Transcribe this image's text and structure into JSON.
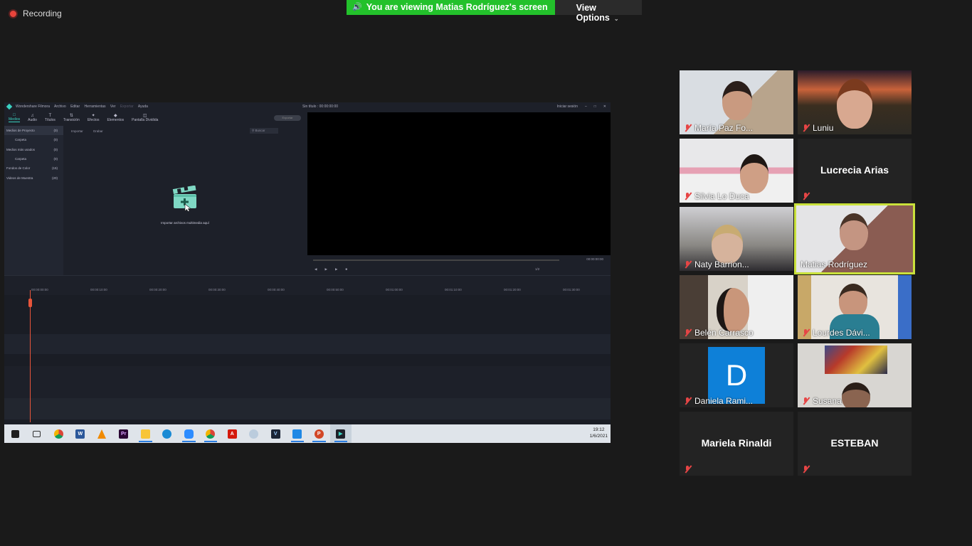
{
  "recording": {
    "label": "Recording"
  },
  "share_banner": {
    "text": "You are viewing Matias Rodríguez's screen",
    "view_options": "View Options"
  },
  "filmora": {
    "app_name": "Wondershare Filmora",
    "menu": [
      "Archivo",
      "Editar",
      "Herramientas",
      "Ver",
      "Exportar",
      "Ayuda"
    ],
    "doc_title": "Sin título : 00:00:00:00",
    "login": "Iniciar sesión",
    "tabs": [
      "Medios",
      "Audio",
      "Títulos",
      "Transición",
      "Efectos",
      "Elementos",
      "Pantalla Dividida"
    ],
    "export_label": "Exportar",
    "library": [
      {
        "label": "Medios de Proyecto",
        "count": "(0)"
      },
      {
        "label": "Carpeta",
        "count": "(0)"
      },
      {
        "label": "Medios más usados",
        "count": "(0)"
      },
      {
        "label": "Carpeta",
        "count": "(0)"
      },
      {
        "label": "Fondos de Color",
        "count": "(15)"
      },
      {
        "label": "Videos de Muestra",
        "count": "(20)"
      }
    ],
    "media_toolbar": {
      "import": "Importar",
      "record": "Grabar",
      "search_placeholder": "Buscar"
    },
    "import_hint": "Importar archivos multimedia aquí",
    "preview_timecode": "00:00:00:00",
    "preview_ratio": "1/2",
    "ruler": [
      "00:00:00:00",
      "00:00:10:00",
      "00:00:20:00",
      "00:00:30:00",
      "00:00:40:00",
      "00:00:50:00",
      "00:01:00:00",
      "00:01:10:00",
      "00:01:20:00",
      "00:01:30:00"
    ]
  },
  "taskbar": {
    "apps": [
      "start-icon",
      "task-view-icon",
      "chrome-icon",
      "word-icon",
      "vlc-icon",
      "premiere-icon",
      "file-explorer-icon",
      "edge-icon",
      "zoom-icon",
      "chrome-icon",
      "acrobat-icon",
      "paint-icon",
      "vegas-icon",
      "movie-maker-icon",
      "powerpoint-icon",
      "filmora-icon"
    ],
    "time": "19:12",
    "date": "1/6/2021"
  },
  "participants": [
    {
      "name": "María Paz Fo...",
      "video": true
    },
    {
      "name": "Luniu",
      "video": true
    },
    {
      "name": "Silvia Lo Duca",
      "video": true
    },
    {
      "name": "Lucrecia Arias",
      "video": false
    },
    {
      "name": "Naty Barrion...",
      "video": true
    },
    {
      "name": "Matias Rodríguez",
      "video": true,
      "speaking": true
    },
    {
      "name": "Belén Carrasco",
      "video": true
    },
    {
      "name": "Lourdes Dávi...",
      "video": true
    },
    {
      "name": "Daniela Rami...",
      "video": false,
      "avatar_letter": "D"
    },
    {
      "name": "Susana",
      "video": true
    },
    {
      "name": "Mariela Rinaldi",
      "video": false
    },
    {
      "name": "ESTEBAN",
      "video": false
    }
  ],
  "colors": {
    "share_green": "#23c12b",
    "speaker_highlight": "#c9e13b",
    "mute_red": "#e64545",
    "avatar_blue": "#0e80d8"
  }
}
